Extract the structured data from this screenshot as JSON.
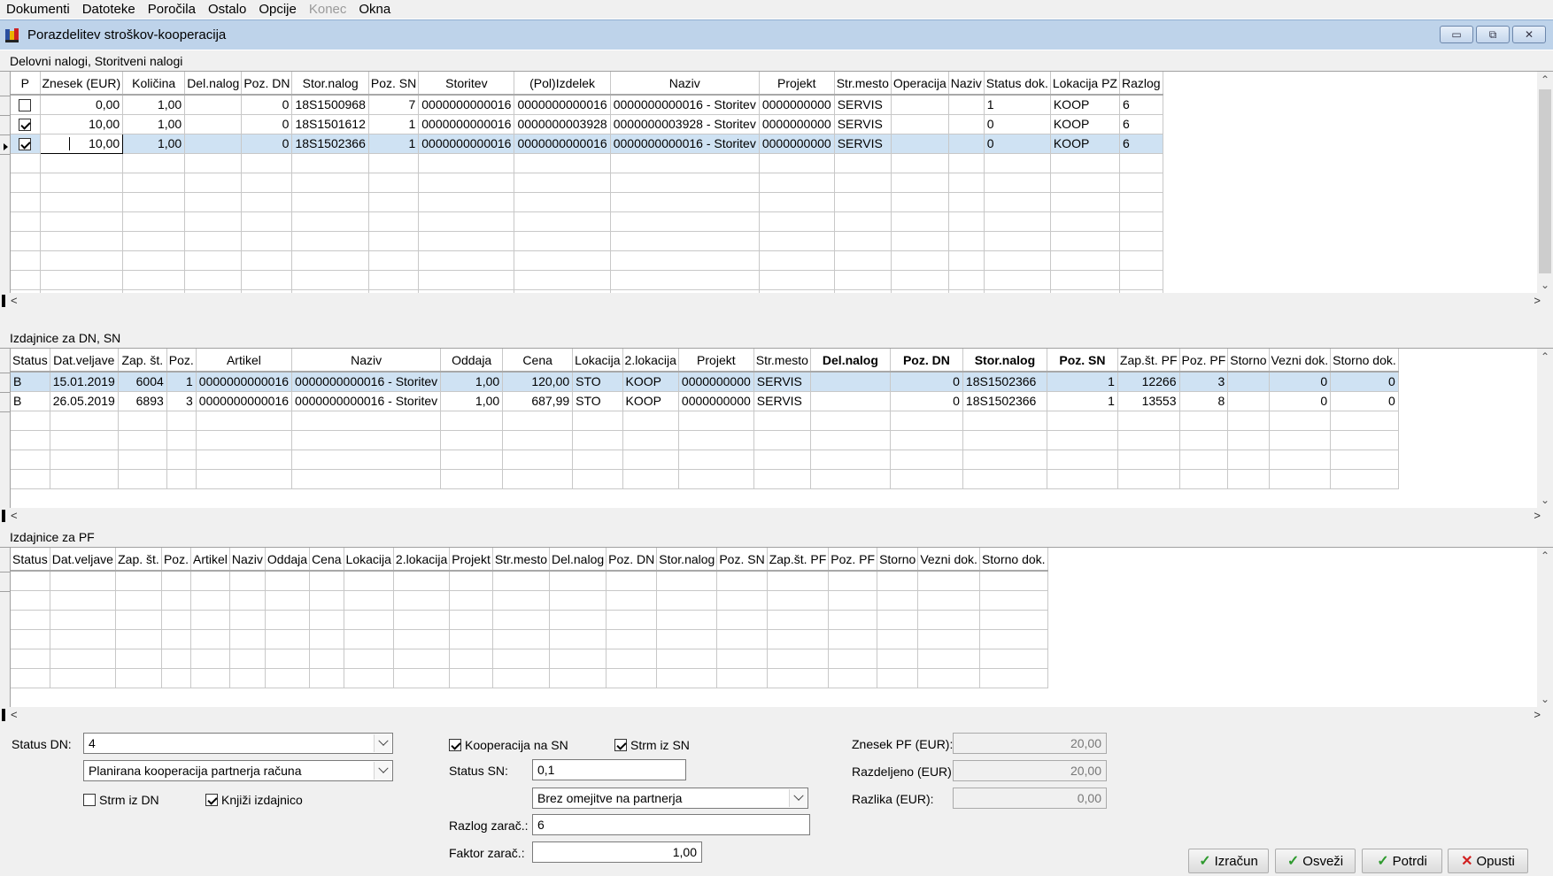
{
  "menu": [
    "Dokumenti",
    "Datoteke",
    "Poročila",
    "Ostalo",
    "Opcije",
    "Konec",
    "Okna"
  ],
  "window": {
    "title": "Porazdelitev stroškov-kooperacija",
    "minimize": "▭",
    "restore": "⧉",
    "close": "✕"
  },
  "colors": {
    "selection": "#cfe2f3",
    "titlebar": "#bed3ea",
    "accent_ok": "#2e9a2e",
    "accent_cancel": "#d12020"
  },
  "grid1": {
    "label": "Delovni nalogi, Storitveni nalogi",
    "columns": [
      "P",
      "Znesek (EUR)",
      "Količina",
      "Del.nalog",
      "Poz. DN",
      "Stor.nalog",
      "Poz. SN",
      "Storitev",
      "(Pol)Izdelek",
      "Naziv",
      "Projekt",
      "Str.mesto",
      "Operacija",
      "Naziv",
      "Status dok.",
      "Lokacija PZ",
      "Razlog"
    ],
    "rows": [
      {
        "checked": false,
        "cells": [
          "",
          "0,00",
          "1,00",
          "",
          "0",
          "18S1500968",
          "7",
          "0000000000016",
          "0000000000016",
          "0000000000016 - Storitev",
          "0000000000",
          "SERVIS",
          "",
          "",
          "1",
          "KOOP",
          "6"
        ]
      },
      {
        "checked": true,
        "cells": [
          "",
          "10,00",
          "1,00",
          "",
          "0",
          "18S1501612",
          "1",
          "0000000000016",
          "0000000003928",
          "0000000003928 - Storitev",
          "0000000000",
          "SERVIS",
          "",
          "",
          "0",
          "KOOP",
          "6"
        ]
      },
      {
        "checked": true,
        "cells": [
          "",
          "10,00",
          "1,00",
          "",
          "0",
          "18S1502366",
          "1",
          "0000000000016",
          "0000000000016",
          "0000000000016 - Storitev",
          "0000000000",
          "SERVIS",
          "",
          "",
          "0",
          "KOOP",
          "6"
        ]
      }
    ]
  },
  "grid2": {
    "label": "Izdajnice za DN, SN",
    "columns": [
      "Status",
      "Dat.veljave",
      "Zap. št.",
      "Poz.",
      "Artikel",
      "Naziv",
      "Oddaja",
      "Cena",
      "Lokacija",
      "2.lokacija",
      "Projekt",
      "Str.mesto",
      "Del.nalog",
      "Poz. DN",
      "Stor.nalog",
      "Poz. SN",
      "Zap.št. PF",
      "Poz. PF",
      "Storno",
      "Vezni dok.",
      "Storno dok."
    ],
    "rows": [
      [
        "B",
        "15.01.2019",
        "6004",
        "1",
        "0000000000016",
        "0000000000016 - Storitev",
        "1,00",
        "120,00",
        "STO",
        "KOOP",
        "0000000000",
        "SERVIS",
        "",
        "0",
        "18S1502366",
        "1",
        "12266",
        "3",
        "",
        "0",
        "0"
      ],
      [
        "B",
        "26.05.2019",
        "6893",
        "3",
        "0000000000016",
        "0000000000016 - Storitev",
        "1,00",
        "687,99",
        "STO",
        "KOOP",
        "0000000000",
        "SERVIS",
        "",
        "0",
        "18S1502366",
        "1",
        "13553",
        "8",
        "",
        "0",
        "0"
      ]
    ]
  },
  "grid3": {
    "label": "Izdajnice za PF",
    "columns": [
      "Status",
      "Dat.veljave",
      "Zap. št.",
      "Poz.",
      "Artikel",
      "Naziv",
      "Oddaja",
      "Cena",
      "Lokacija",
      "2.lokacija",
      "Projekt",
      "Str.mesto",
      "Del.nalog",
      "Poz. DN",
      "Stor.nalog",
      "Poz. SN",
      "Zap.št. PF",
      "Poz. PF",
      "Storno",
      "Vezni dok.",
      "Storno dok."
    ]
  },
  "form": {
    "status_dn_label": "Status DN:",
    "status_dn_value": "4",
    "status_dn_desc": "Planirana kooperacija partnerja računa",
    "strm_iz_dn_label": "Strm iz DN",
    "strm_iz_dn_checked": false,
    "knjizi_label": "Knjiži izdajnico",
    "knjizi_checked": true,
    "kooperacija_label": "Kooperacija na SN",
    "kooperacija_checked": true,
    "strm_iz_sn_label": "Strm iz SN",
    "strm_iz_sn_checked": true,
    "status_sn_label": "Status SN:",
    "status_sn_value": "0,1",
    "partner_value": "Brez omejitve na partnerja",
    "razlog_label": "Razlog zarač.:",
    "razlog_value": "6",
    "faktor_label": "Faktor zarač.:",
    "faktor_value": "1,00",
    "znesek_pf_label": "Znesek PF (EUR):",
    "znesek_pf_value": "20,00",
    "razdeljeno_label": "Razdeljeno (EUR):",
    "razdeljeno_value": "20,00",
    "razlika_label": "Razlika (EUR):",
    "razlika_value": "0,00"
  },
  "buttons": {
    "izracun": "Izračun",
    "osvezi": "Osveži",
    "potrdi": "Potrdi",
    "opusti": "Opusti",
    "icon_ok": "✓",
    "icon_cancel": "✕"
  },
  "scroll": {
    "up": "⌃",
    "down": "⌄",
    "left": "<",
    "right": ">"
  }
}
